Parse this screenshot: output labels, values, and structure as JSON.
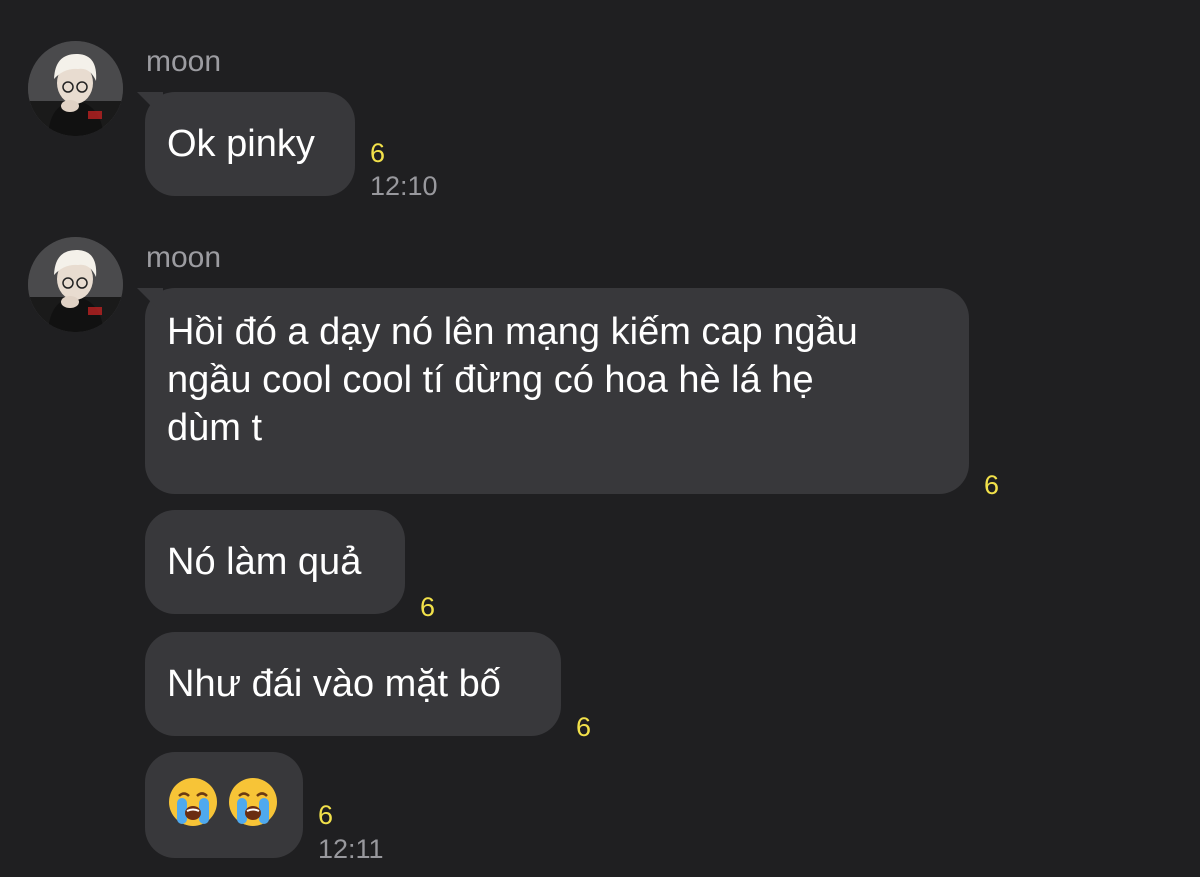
{
  "messages": [
    {
      "sender": "moon",
      "text": "Ok pinky",
      "read": "6",
      "time": "12:10"
    },
    {
      "sender": "moon",
      "text": "Hồi đó a dạy nó lên mạng kiếm cap ngầu\nngầu cool cool tí đừng có hoa hè lá hẹ\ndùm t",
      "read": "6"
    },
    {
      "text": "Nó làm quả",
      "read": "6"
    },
    {
      "text": "Như đái vào mặt bố",
      "read": "6"
    },
    {
      "emoji": [
        "😭",
        "😭"
      ],
      "emoji_names": [
        "loudly-crying-face-icon",
        "loudly-crying-face-icon"
      ],
      "read": "6",
      "time": "12:11"
    }
  ],
  "colors": {
    "background": "#1f1f21",
    "bubble": "#38383b",
    "sender": "#9c9ca1",
    "read_count": "#f2e14a",
    "time": "#98989d"
  }
}
